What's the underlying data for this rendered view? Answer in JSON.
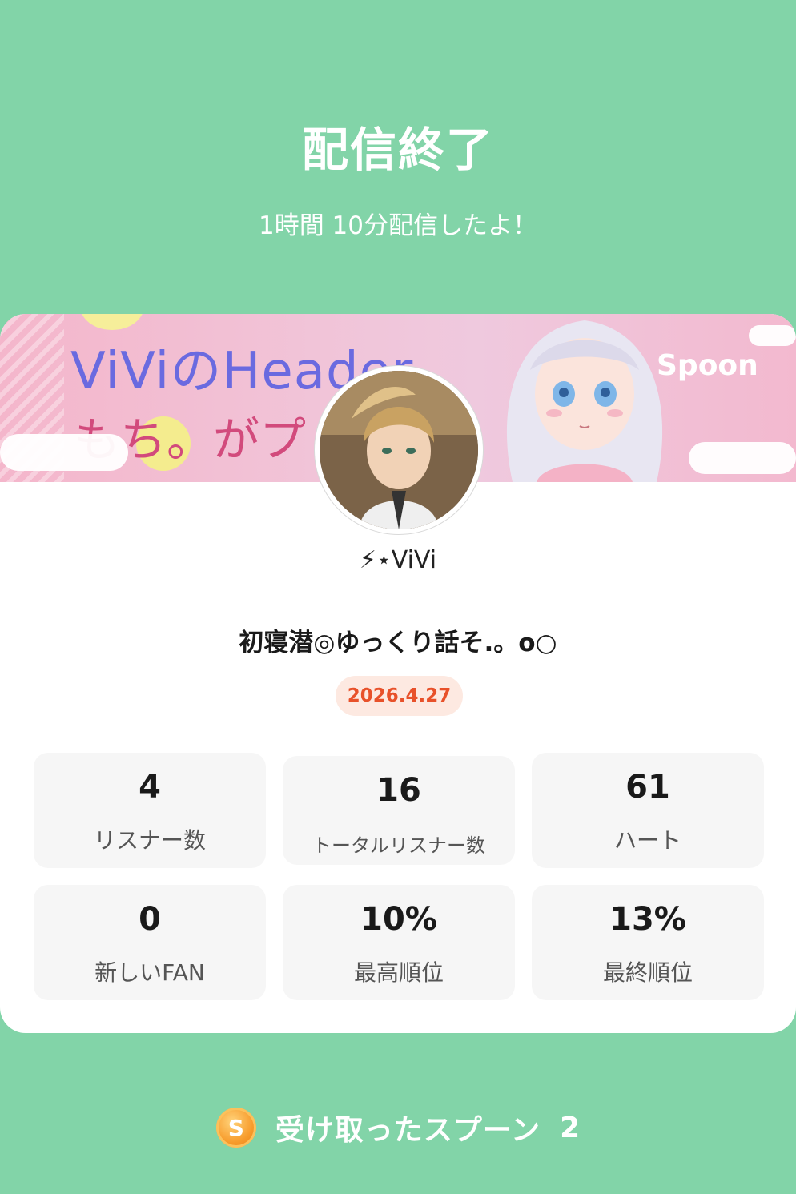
{
  "header": {
    "title": "配信終了",
    "subtitle": "1時間 10分配信したよ！"
  },
  "banner": {
    "text_line1": "ViViのHeader",
    "text_line2": "もち。がプ",
    "brand": "Spoon"
  },
  "profile": {
    "username": "⚡︎⋆ViVi"
  },
  "live": {
    "title": "初寝潜◎ゆっくり話そ.。o○",
    "date": "2026.4.27"
  },
  "stats": [
    {
      "value": "4",
      "label": "リスナー数"
    },
    {
      "value": "16",
      "label": "トータルリスナー数"
    },
    {
      "value": "61",
      "label": "ハート"
    },
    {
      "value": "0",
      "label": "新しいFAN"
    },
    {
      "value": "10%",
      "label": "最高順位"
    },
    {
      "value": "13%",
      "label": "最終順位"
    }
  ],
  "spoons": {
    "icon": "S",
    "label": "受け取ったスプーン",
    "count": "2"
  },
  "colors": {
    "background": "#82d4a8",
    "date_text": "#e8512a",
    "date_badge": "#fde9e1",
    "stat_card": "#f6f6f6"
  }
}
